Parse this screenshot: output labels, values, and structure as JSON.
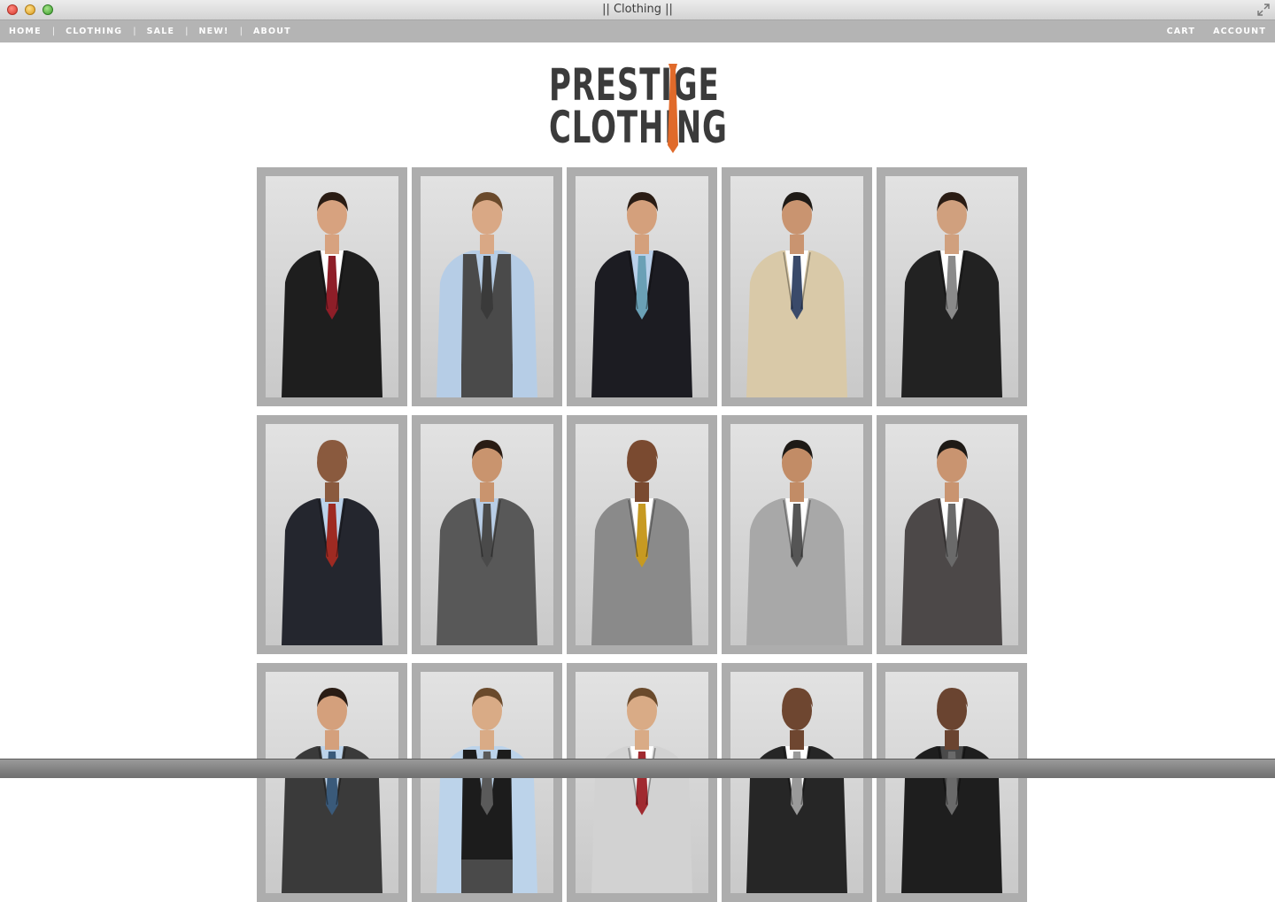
{
  "window": {
    "title": "|| Clothing ||"
  },
  "nav": {
    "left": [
      {
        "label": "HOME"
      },
      {
        "label": "CLOTHING"
      },
      {
        "label": "SALE"
      },
      {
        "label": "NEW!"
      },
      {
        "label": "ABOUT"
      }
    ],
    "separator": "|",
    "right": [
      {
        "label": "CART"
      },
      {
        "label": "ACCOUNT"
      }
    ]
  },
  "logo": {
    "line1": "PRESTIGE",
    "line2": "CLOTHING",
    "tie_color": "#e06a2a",
    "text_color": "#3b3b3b"
  },
  "products": [
    {
      "suit": "#1e1e1e",
      "tie": "#8e1e28",
      "shirt": "#ffffff",
      "skin": "#d7a27f",
      "hair": "#2a1c14"
    },
    {
      "suit": "#4a4a4a",
      "tie": "#3a3a3a",
      "shirt": "#b6cde6",
      "skin": "#d9a885",
      "hair": "#6a4a2c",
      "vest": true
    },
    {
      "suit": "#1c1c22",
      "tie": "#6aa0b6",
      "shirt": "#b9d0ea",
      "skin": "#d4a07c",
      "hair": "#2a1c14"
    },
    {
      "suit": "#d9c9a8",
      "tie": "#3a4a6a",
      "shirt": "#ffffff",
      "skin": "#c99470",
      "hair": "#1e1a16"
    },
    {
      "suit": "#222222",
      "tie": "#8a8a8a",
      "shirt": "#ffffff",
      "skin": "#d0a07e",
      "hair": "#2a1c14"
    },
    {
      "suit": "#24262e",
      "tie": "#9e2a22",
      "shirt": "#bcd3ea",
      "skin": "#8a5a3e",
      "hair": "#8a5a3e"
    },
    {
      "suit": "#585858",
      "tie": "#4a4a4a",
      "shirt": "#b8cde6",
      "skin": "#c9946e",
      "hair": "#2a1c14"
    },
    {
      "suit": "#8a8a8a",
      "tie": "#c79a22",
      "shirt": "#ffffff",
      "skin": "#7a4a30",
      "hair": "#7a4a30"
    },
    {
      "suit": "#a8a8a8",
      "tie": "#555555",
      "shirt": "#ffffff",
      "skin": "#c28c66",
      "hair": "#1e1a16"
    },
    {
      "suit": "#4c4848",
      "tie": "#6a6a6a",
      "shirt": "#ffffff",
      "skin": "#c99470",
      "hair": "#1e1a16"
    },
    {
      "suit": "#3a3a3a",
      "tie": "#3a5a7a",
      "shirt": "#bcd3ea",
      "skin": "#d4a07c",
      "hair": "#2a1c14"
    },
    {
      "suit": "#1c1c1c",
      "tie": "#5a5a5a",
      "shirt": "#bcd3ea",
      "skin": "#d9ab86",
      "hair": "#6a4a2c",
      "vest": true
    },
    {
      "suit": "#d2d2d2",
      "tie": "#a02a30",
      "shirt": "#ffffff",
      "skin": "#d9ab86",
      "hair": "#6a4a2c"
    },
    {
      "suit": "#262626",
      "tie": "#9a9a9a",
      "shirt": "#ffffff",
      "skin": "#6e4630",
      "hair": "#6e4630"
    },
    {
      "suit": "#1e1e1e",
      "tie": "#6a6a6a",
      "shirt": "#4a4a4a",
      "skin": "#6a4430",
      "hair": "#6a4430"
    }
  ]
}
